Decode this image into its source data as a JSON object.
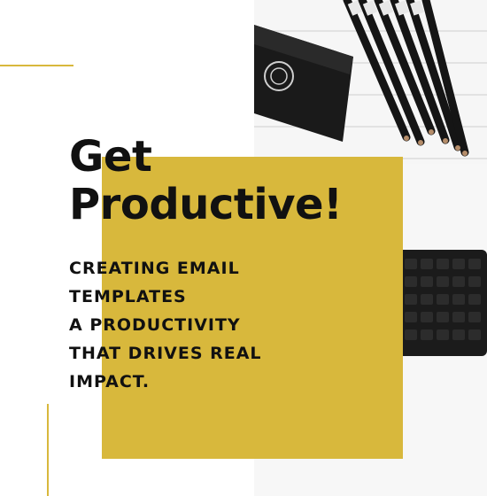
{
  "headline": {
    "line1": "Get",
    "line2": "Productive!"
  },
  "subtext": {
    "lines": [
      "CREATING EMAIL",
      "TEMPLATES",
      "A PRODUCTIVITY",
      "THAT DRIVES REAL",
      "IMPACT."
    ]
  },
  "colors": {
    "accent": "#d8b83c",
    "text": "#111111",
    "background": "#ffffff"
  },
  "photo": {
    "objects": [
      "black-wallet-icon",
      "black-pencils-icon",
      "black-keyboard-icon"
    ]
  }
}
